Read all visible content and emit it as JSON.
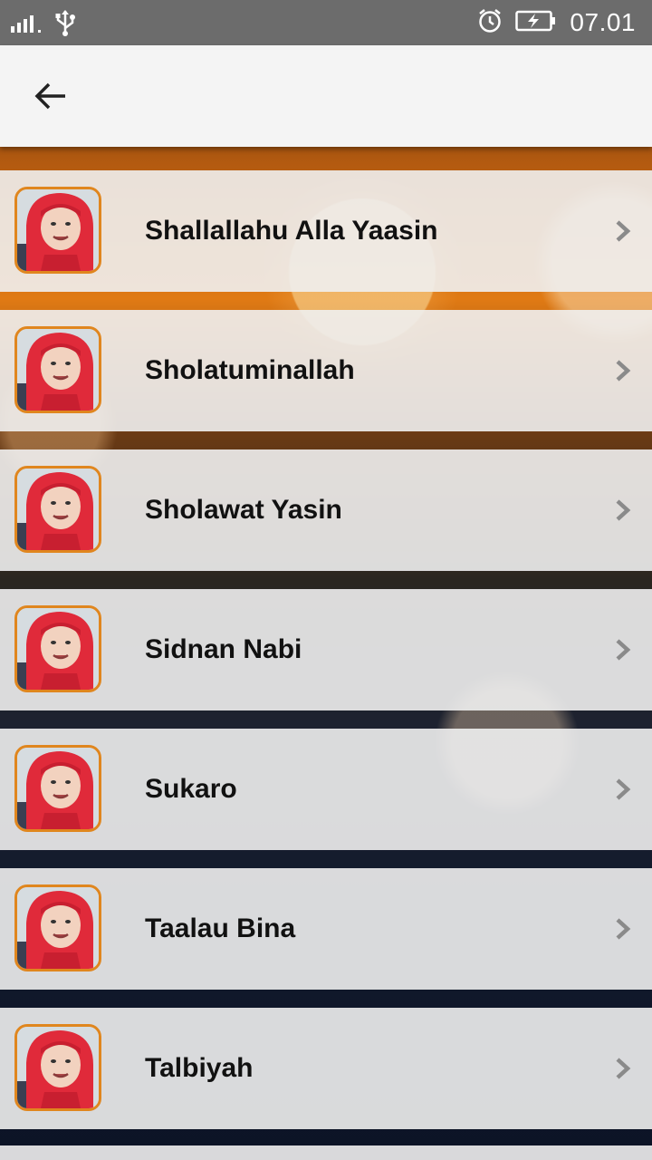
{
  "status_bar": {
    "time": "07.01",
    "icons": [
      "signal-icon",
      "usb-icon",
      "alarm-icon",
      "battery-charging-icon"
    ]
  },
  "app_bar": {
    "back_icon": "arrow-left-icon"
  },
  "list": {
    "items": [
      {
        "title": "Shallallahu Alla Yaasin"
      },
      {
        "title": "Sholatuminallah"
      },
      {
        "title": "Sholawat Yasin"
      },
      {
        "title": "Sidnan Nabi"
      },
      {
        "title": "Sukaro"
      },
      {
        "title": "Taalau Bina"
      },
      {
        "title": "Talbiyah"
      }
    ]
  },
  "colors": {
    "status_bar": "#6c6c6c",
    "app_bar": "#f4f4f4",
    "thumb_border": "#e0861e",
    "hijab": "#e02a3a"
  }
}
